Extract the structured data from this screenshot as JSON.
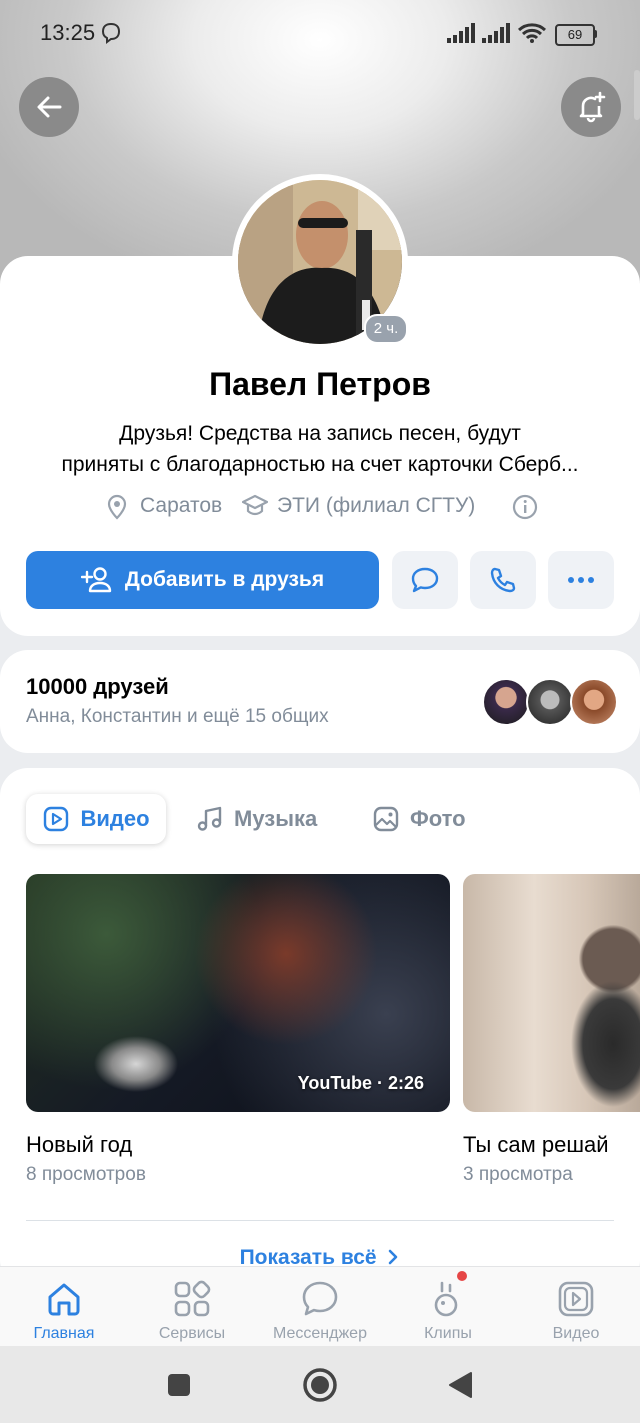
{
  "status_bar": {
    "time": "13:25",
    "battery": "69"
  },
  "profile": {
    "name": "Павел Петров",
    "status_line1": "Друзья! Средства на запись песен, будут",
    "status_line2": "приняты с благодарностью на счет карточки Сберб...",
    "online_badge": "2 ч.",
    "city": "Саратов",
    "education": "ЭТИ (филиал СГТУ)",
    "add_friend_label": "Добавить в друзья"
  },
  "friends": {
    "count_label": "10000 друзей",
    "common_label": "Анна, Константин и ещё 15 общих"
  },
  "media": {
    "tabs": [
      {
        "label": "Видео",
        "icon": "video-icon",
        "active": true
      },
      {
        "label": "Музыка",
        "icon": "music-icon",
        "active": false
      },
      {
        "label": "Фото",
        "icon": "photo-icon",
        "active": false
      }
    ],
    "videos": [
      {
        "title": "Новый год",
        "views": "8 просмотров",
        "source_duration": "YouTube · 2:26"
      },
      {
        "title": "Ты сам решай",
        "views": "3 просмотра"
      }
    ],
    "show_all": "Показать всё"
  },
  "bottom_nav": [
    {
      "label": "Главная",
      "icon": "home-icon",
      "active": true
    },
    {
      "label": "Сервисы",
      "icon": "services-icon",
      "active": false
    },
    {
      "label": "Мессенджер",
      "icon": "messenger-icon",
      "active": false
    },
    {
      "label": "Клипы",
      "icon": "clips-icon",
      "active": false
    },
    {
      "label": "Видео",
      "icon": "video-nav-icon",
      "active": false
    }
  ],
  "colors": {
    "accent": "#2d81e0",
    "secondary_text": "#818c99",
    "notification_dot": "#e64646"
  }
}
